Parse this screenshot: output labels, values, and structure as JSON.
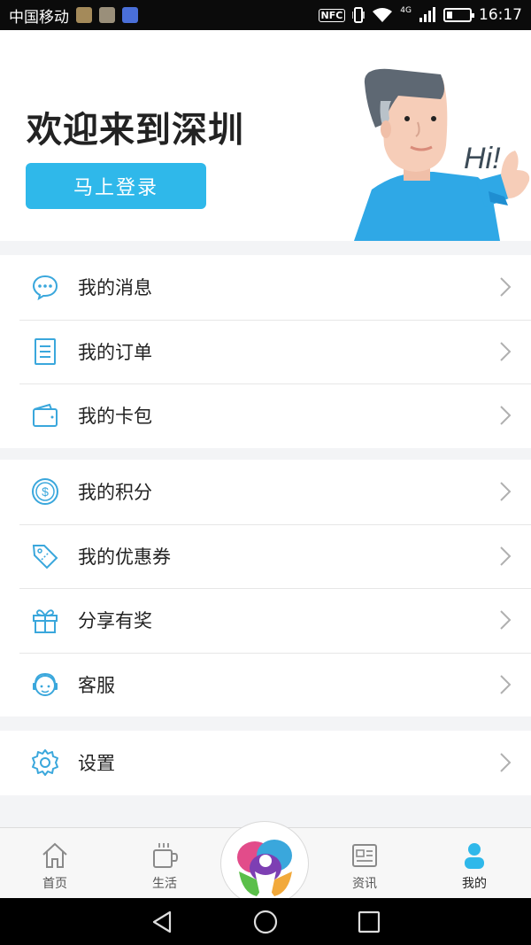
{
  "status_bar": {
    "carrier": "中国移动",
    "network": "4G",
    "time": "16:17",
    "nfc": "NFC"
  },
  "hero": {
    "title": "欢迎来到深圳",
    "login_button": "马上登录",
    "mascot_text": "Hi!"
  },
  "menu_groups": [
    {
      "items": [
        {
          "label": "我的消息",
          "icon": "message-icon"
        },
        {
          "label": "我的订单",
          "icon": "order-icon"
        },
        {
          "label": "我的卡包",
          "icon": "wallet-icon"
        }
      ]
    },
    {
      "items": [
        {
          "label": "我的积分",
          "icon": "coin-icon"
        },
        {
          "label": "我的优惠券",
          "icon": "coupon-icon"
        },
        {
          "label": "分享有奖",
          "icon": "gift-icon"
        },
        {
          "label": "客服",
          "icon": "customer-service-icon"
        }
      ]
    },
    {
      "items": [
        {
          "label": "设置",
          "icon": "gear-icon"
        }
      ]
    }
  ],
  "tabbar": {
    "tabs": [
      {
        "label": "首页",
        "icon": "home-icon"
      },
      {
        "label": "生活",
        "icon": "coffee-cup-icon"
      },
      {
        "label": "",
        "icon": "app-logo-icon"
      },
      {
        "label": "资讯",
        "icon": "news-icon"
      },
      {
        "label": "我的",
        "icon": "user-icon"
      }
    ],
    "active_index": 4
  },
  "colors": {
    "accent": "#2fb8ea",
    "icon_blue": "#3aa7dc"
  }
}
